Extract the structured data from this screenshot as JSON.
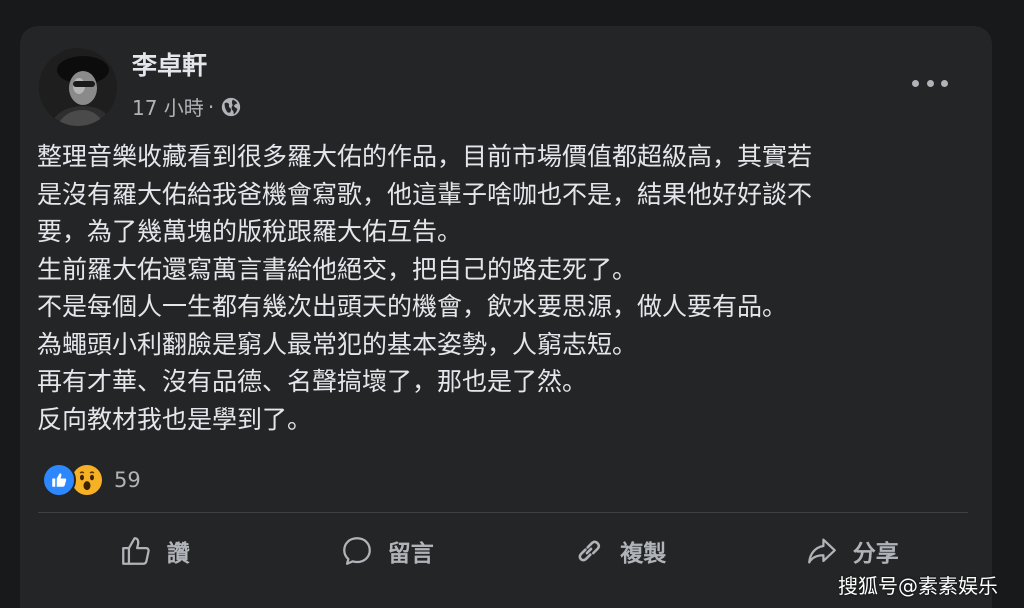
{
  "post": {
    "author": "李卓軒",
    "time": "17 小時",
    "separator": "·",
    "body_lines": [
      "整理音樂收藏看到很多羅大佑的作品，目前市場價值都超級高，其實若",
      "是沒有羅大佑給我爸機會寫歌，他這輩子啥咖也不是，結果他好好談不",
      "要，為了幾萬塊的版稅跟羅大佑互告。",
      "生前羅大佑還寫萬言書給他絕交，把自己的路走死了。",
      "不是每個人一生都有幾次出頭天的機會，飲水要思源，做人要有品。",
      "為蠅頭小利翻臉是窮人最常犯的基本姿勢，人窮志短。",
      "再有才華、沒有品德、名聲搞壞了，那也是了然。",
      "反向教材我也是學到了。"
    ],
    "reaction_count": "59"
  },
  "actions": {
    "like": "讚",
    "comment": "留言",
    "copy": "複製",
    "share": "分享"
  },
  "icons": {
    "avatar": "avatar",
    "audience": "globe-icon",
    "more": "more-icon",
    "like_reaction": "like-icon",
    "wow_reaction": "wow-icon",
    "like_action": "thumbs-up-icon",
    "comment_action": "comment-icon",
    "copy_action": "link-icon",
    "share_action": "share-icon"
  },
  "watermark": "搜狐号@素素娱乐",
  "colors": {
    "background": "#18191a",
    "card": "#242526",
    "text_primary": "#e4e6eb",
    "text_secondary": "#b0b3b8",
    "like_blue": "#2d88ff",
    "wow_yellow": "#f7b125"
  }
}
